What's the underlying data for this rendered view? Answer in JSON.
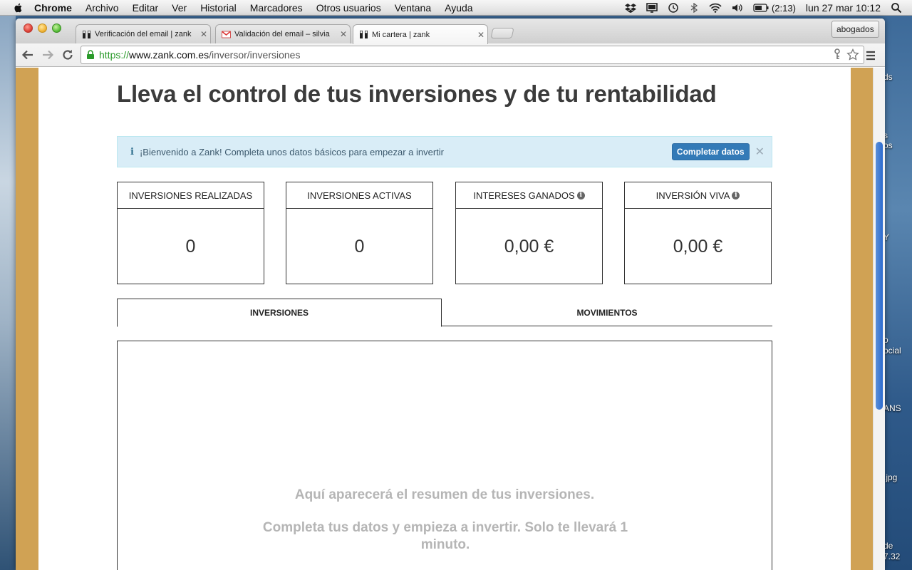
{
  "menubar": {
    "app": "Chrome",
    "menus": [
      "Archivo",
      "Editar",
      "Ver",
      "Historial",
      "Marcadores",
      "Otros usuarios",
      "Ventana",
      "Ayuda"
    ],
    "battery": "(2:13)",
    "datetime": "lun 27 mar  10:12"
  },
  "browser": {
    "tabs": [
      {
        "title": "Verificación del email | zank",
        "icon": "zank-icon"
      },
      {
        "title": "Validación del email – silvia",
        "icon": "gmail-icon"
      },
      {
        "title": "Mi cartera | zank",
        "icon": "zank-icon",
        "active": true
      }
    ],
    "profile": "abogados",
    "url": {
      "scheme": "https://",
      "host": "www.zank.com.es",
      "path": "/inversor/inversiones"
    }
  },
  "desktop_labels": [
    "ds",
    "s",
    "os",
    "Y",
    "o",
    "ocial",
    "ANS",
    ".jpg",
    "de",
    "7.32"
  ],
  "page": {
    "title": "Lleva el control de tus inversiones y de tu rentabilidad",
    "alert": {
      "message": "¡Bienvenido a Zank! Completa unos datos básicos para empezar a invertir",
      "button": "Completar datos"
    },
    "stats": [
      {
        "label": "INVERSIONES REALIZADAS",
        "value": "0",
        "info": false
      },
      {
        "label": "INVERSIONES ACTIVAS",
        "value": "0",
        "info": false
      },
      {
        "label": "INTERESES GANADOS",
        "value": "0,00 €",
        "info": true
      },
      {
        "label": "INVERSIÓN VIVA",
        "value": "0,00 €",
        "info": true
      }
    ],
    "tabs": [
      "INVERSIONES",
      "MOVIMIENTOS"
    ],
    "empty_title": "Aquí aparecerá el resumen de tus inversiones.",
    "empty_subtitle": "Completa tus datos y empieza a invertir. Solo te llevará 1 minuto."
  },
  "colors": {
    "page_side": "#d0a254",
    "alert_bg": "#d9edf7",
    "button_blue": "#337ab7",
    "url_green": "#2a9a2a"
  }
}
